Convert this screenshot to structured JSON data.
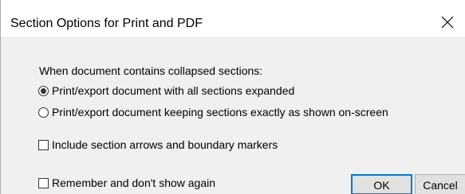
{
  "window": {
    "title": "Section Options for Print and PDF",
    "close_glyph": "✕"
  },
  "collapsed_group": {
    "label": "When document contains collapsed sections:",
    "options": [
      {
        "label": "Print/export document with all sections expanded",
        "selected": true
      },
      {
        "label": "Print/export document keeping sections exactly as shown on-screen",
        "selected": false
      }
    ]
  },
  "checkboxes": {
    "include_arrows": {
      "label": "Include section arrows and boundary markers",
      "checked": false
    },
    "remember": {
      "label": "Remember and don't show again",
      "checked": false
    }
  },
  "buttons": {
    "ok": "OK",
    "cancel": "Cancel"
  },
  "colors": {
    "dialog_bg": "#f0f0f0",
    "titlebar_bg": "#ffffff",
    "default_button_border": "#0078d7"
  }
}
